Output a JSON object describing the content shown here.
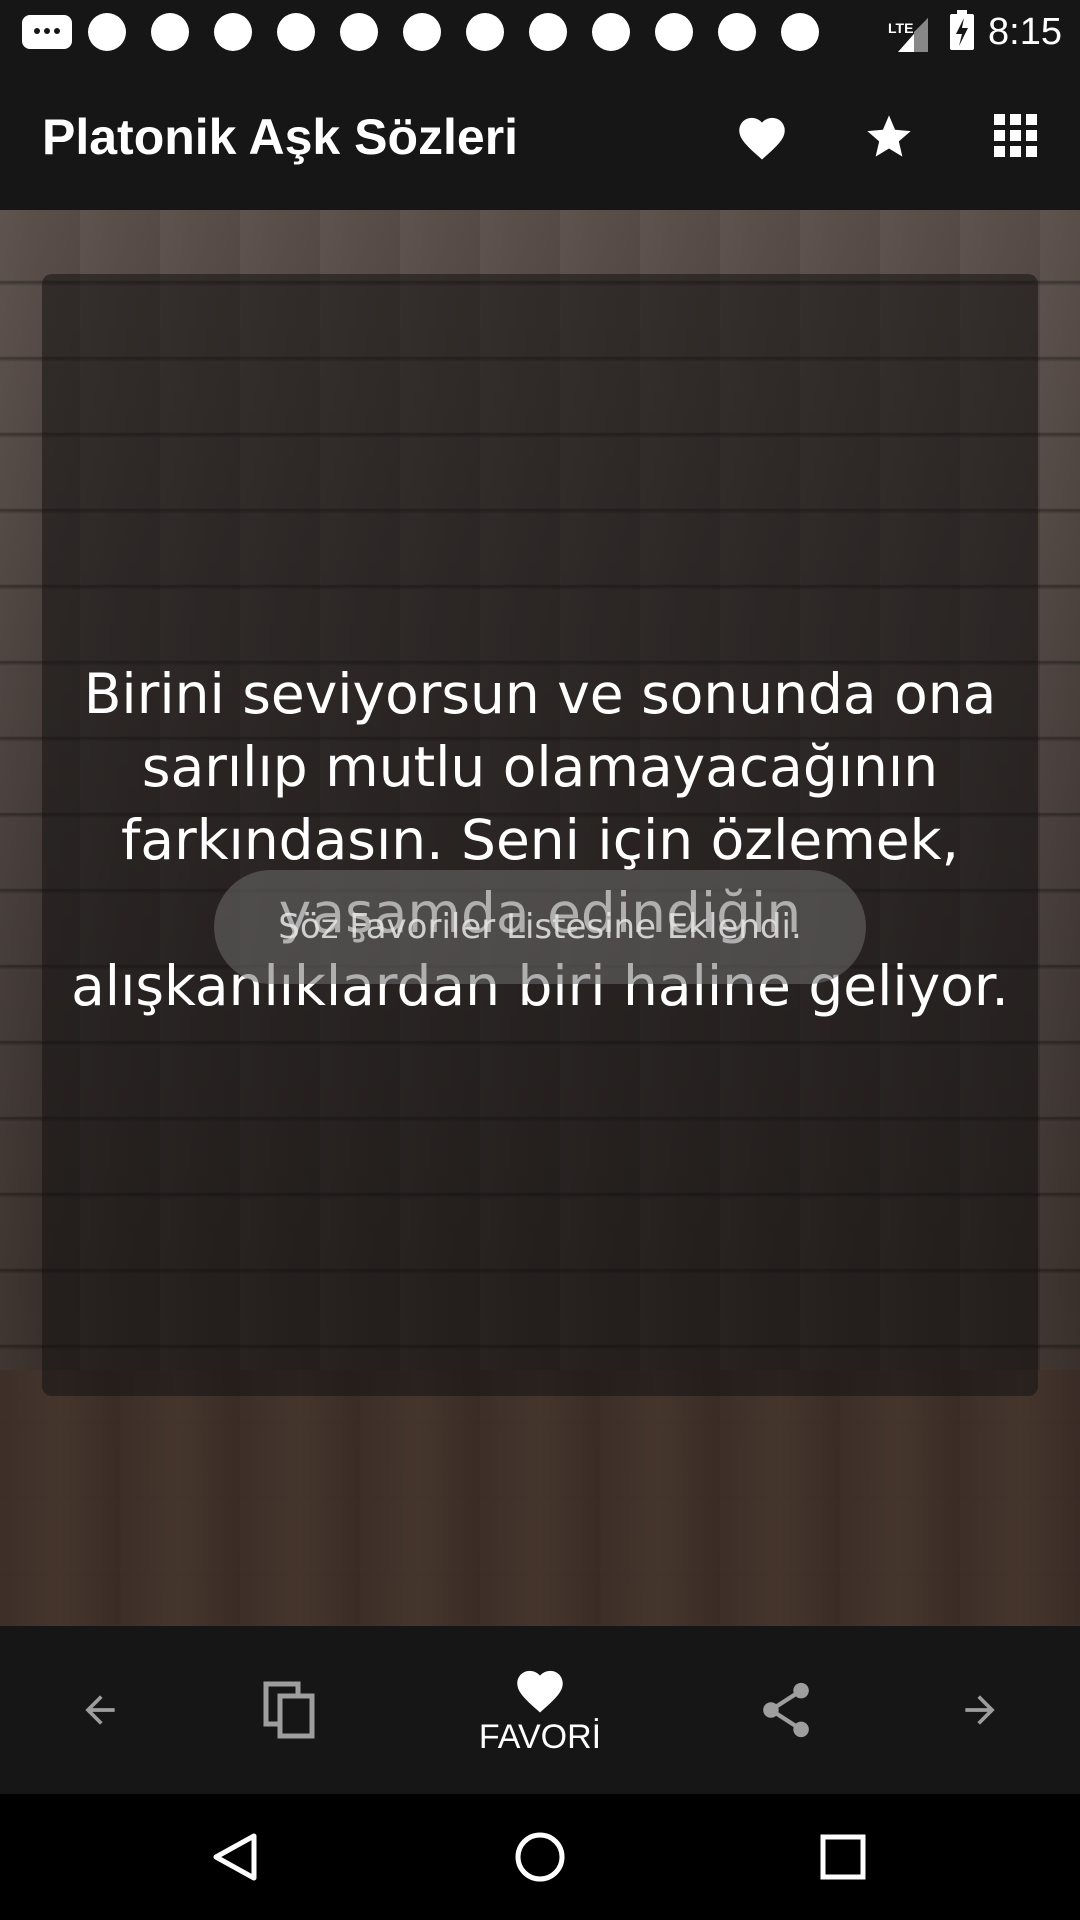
{
  "status_bar": {
    "network": "LTE",
    "time": "8:15",
    "notification_dot_count": 12
  },
  "app_bar": {
    "title": "Platonik Aşk Sözleri",
    "icons": [
      "heart-icon",
      "star-icon",
      "grid-menu-icon"
    ]
  },
  "quote": {
    "text": "Birini seviyorsun ve sonunda ona sarılıp mutlu olamayacağının farkındasın. Seni için özlemek, yaşamda edindiğin alışkanlıklardan biri haline geliyor."
  },
  "toast": {
    "message": "Söz Favoriler Listesine Eklendi."
  },
  "action_bar": {
    "favorite_label": "FAVORİ",
    "icons": [
      "arrow-left-icon",
      "copy-icon",
      "heart-icon",
      "share-icon",
      "arrow-right-icon"
    ]
  },
  "nav_bar": {
    "icons": [
      "back-triangle-icon",
      "home-circle-icon",
      "recents-square-icon"
    ]
  },
  "colors": {
    "bar_background": "#161616",
    "text": "#ffffff",
    "icon_gray": "#9e9e9e"
  }
}
